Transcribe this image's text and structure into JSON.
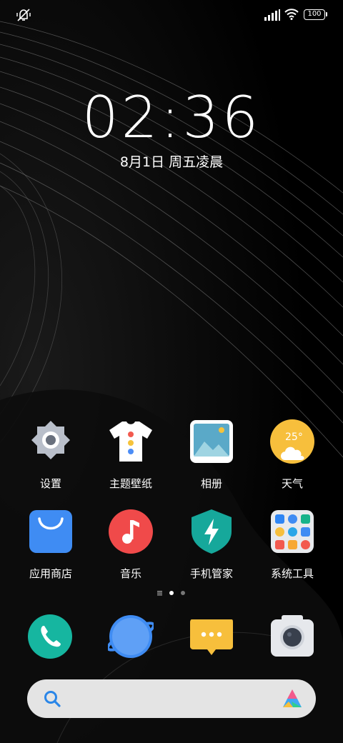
{
  "status_bar": {
    "left_icon": "mute-vibrate-icon",
    "signal_icon": "signal-icon",
    "wifi_icon": "wifi-icon",
    "battery_level": "100"
  },
  "lockscreen": {
    "time": "02:36",
    "date": "8月1日 周五凌晨"
  },
  "apps": [
    {
      "label": "设置",
      "icon": "settings-icon"
    },
    {
      "label": "主题壁纸",
      "icon": "theme-icon"
    },
    {
      "label": "相册",
      "icon": "gallery-icon"
    },
    {
      "label": "天气",
      "icon": "weather-icon",
      "temp": "25°"
    },
    {
      "label": "应用商店",
      "icon": "app-store-icon"
    },
    {
      "label": "音乐",
      "icon": "music-icon"
    },
    {
      "label": "手机管家",
      "icon": "security-icon"
    },
    {
      "label": "系统工具",
      "icon": "folder-icon"
    }
  ],
  "page_indicator": {
    "pages": 3,
    "current": 2
  },
  "dock": [
    {
      "icon": "phone-icon"
    },
    {
      "icon": "browser-icon"
    },
    {
      "icon": "messages-icon"
    },
    {
      "icon": "camera-icon"
    }
  ],
  "search_bar": {
    "search_icon": "search-icon",
    "assistant_icon": "assistant-icon"
  }
}
